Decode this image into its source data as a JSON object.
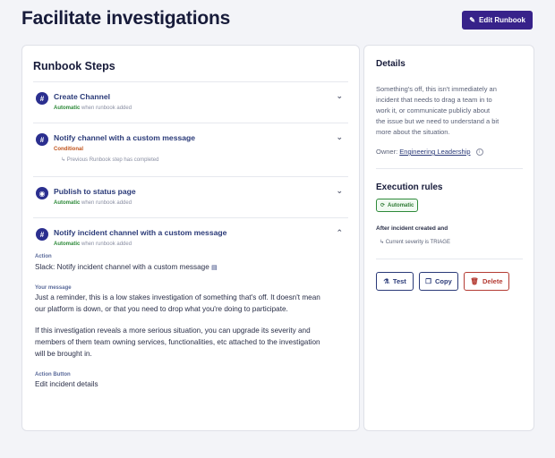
{
  "page": {
    "title": "Facilitate investigations",
    "edit_button": "Edit Runbook"
  },
  "runbook": {
    "title": "Runbook Steps",
    "steps": [
      {
        "title": "Create Channel",
        "tag": "Automatic",
        "trigger": "when runbook added"
      },
      {
        "title": "Notify channel with a custom message",
        "tag": "Conditional",
        "note": "Previous Runbook step has completed"
      },
      {
        "title": "Publish to status page",
        "tag": "Automatic",
        "trigger": "when runbook added"
      },
      {
        "title": "Notify incident channel with a custom message",
        "tag": "Automatic",
        "trigger": "when runbook added"
      }
    ],
    "expanded": {
      "action_label": "Action",
      "action_value": "Slack: Notify incident channel with a custom message",
      "message_label": "Your message",
      "message_lines": [
        "Just a reminder, this is a low stakes investigation of something that's off. It doesn't mean",
        "our platform is down, or that you need to drop what you're doing to participate.",
        "If this investigation reveals a more serious situation, you can upgrade its severity and",
        "members of them team owning services, functionalities, etc attached to the investigation",
        "will be brought in."
      ],
      "action_button_label": "Action Button",
      "action_button_value": "Edit incident details"
    }
  },
  "details": {
    "title": "Details",
    "description_lines": [
      "Something's off, this isn't immediately an",
      "incident that needs to drag a team in to",
      "work it, or communicate publicly about",
      "the issue but we need to understand a bit",
      "more about the situation."
    ],
    "owner_label": "Owner:",
    "owner_value": "Engineering Leadership",
    "execution_title": "Execution rules",
    "execution_badge": "Automatic",
    "after_title": "After incident created and",
    "after_condition": "Current severity is TRIAGE",
    "buttons": {
      "test": "Test",
      "copy": "Copy",
      "delete": "Delete"
    }
  },
  "icons": {
    "step_slack": "slack-hash-icon",
    "step_status": "broadcast-icon",
    "chevron_down": "chevron-down-icon",
    "chevron_up": "chevron-up-icon"
  },
  "colors": {
    "primary": "#37228a",
    "automatic": "#2e8a3a",
    "conditional": "#c0531b",
    "danger": "#b43b33"
  }
}
